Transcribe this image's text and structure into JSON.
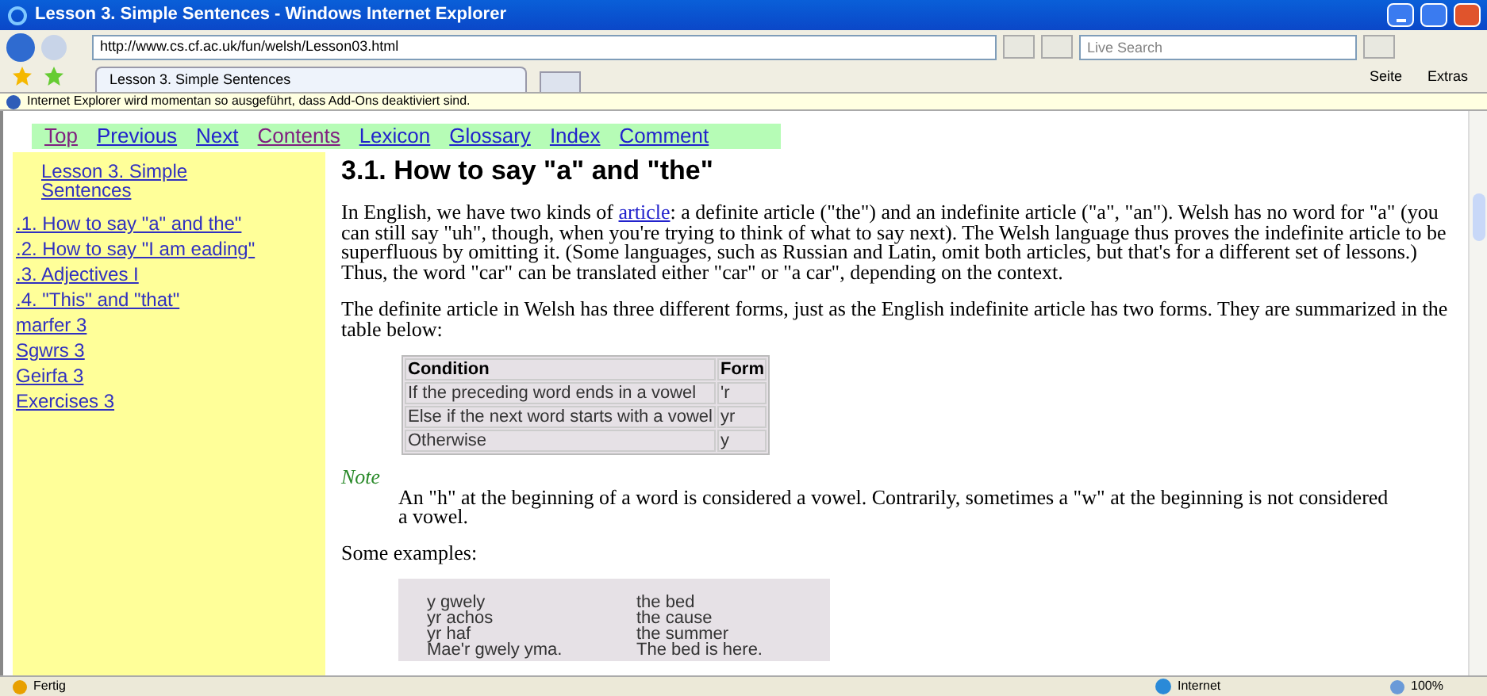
{
  "window": {
    "title": "Lesson 3. Simple Sentences - Windows Internet Explorer"
  },
  "address_bar": {
    "url": "http://www.cs.cf.ac.uk/fun/welsh/Lesson03.html",
    "search_placeholder": "Live Search"
  },
  "tabs": [
    {
      "label": "Lesson 3. Simple Sentences",
      "selected": true
    }
  ],
  "command_bar": [
    "Seite",
    "Extras"
  ],
  "info_bar": "Internet Explorer wird momentan so ausgeführt, dass Add-Ons deaktiviert sind.",
  "nav_links": [
    {
      "label": "Top",
      "visited": true
    },
    {
      "label": "Previous",
      "visited": false
    },
    {
      "label": "Next",
      "visited": false
    },
    {
      "label": "Contents",
      "visited": true
    },
    {
      "label": "Lexicon",
      "visited": false
    },
    {
      "label": "Glossary",
      "visited": false
    },
    {
      "label": "Index",
      "visited": false
    },
    {
      "label": "Comment",
      "visited": false
    }
  ],
  "sidebar": {
    "title": "Lesson 3. Simple Sentences",
    "items": [
      ".1. How to say \"a\" and the\"",
      ".2. How to say \"I am eading\"",
      ".3. Adjectives I",
      ".4. \"This\" and \"that\"",
      "marfer 3",
      "Sgwrs 3",
      "Geirfa 3",
      "Exercises 3"
    ]
  },
  "heading": "3.1. How to say \"a\" and \"the\"",
  "paragraph_1": {
    "before": "In English, we have two kinds of ",
    "link": "article",
    "after": ": a definite article (\"the\") and an indefinite article (\"a\", \"an\"). Welsh has no word for \"a\" (you can still say \"uh\", though, when you're trying to think of what to say next). The Welsh language thus proves the indefinite article to be superfluous by omitting it. (Some languages, such as Russian and Latin, omit both articles, but that's for a different set of lessons.) Thus, the word \"car\" can be translated either \"car\" or \"a car\", depending on the context."
  },
  "paragraph_2": "The definite article in Welsh has three different forms, just as the English indefinite article has two forms. They are summarized in the table below:",
  "table": {
    "columns": [
      "Condition",
      "Form"
    ],
    "rows": [
      [
        "If the preceding word ends in a vowel",
        "'r"
      ],
      [
        "Else if the next word starts with a vowel",
        "yr"
      ],
      [
        "Otherwise",
        "y"
      ]
    ]
  },
  "note": {
    "label": "Note",
    "text": "An \"h\" at the beginning of a word is considered a vowel. Contrarily, sometimes a \"w\" at the beginning is not considered a vowel."
  },
  "examples_intro": "Some examples:",
  "examples": [
    [
      "y gwely",
      "the bed"
    ],
    [
      "yr achos",
      "the cause"
    ],
    [
      "yr haf",
      "the summer"
    ],
    [
      "Mae'r gwely yma.",
      "The bed is here."
    ]
  ],
  "status_bar": {
    "text": "Fertig",
    "zone": "Internet",
    "zoom": "100%"
  }
}
